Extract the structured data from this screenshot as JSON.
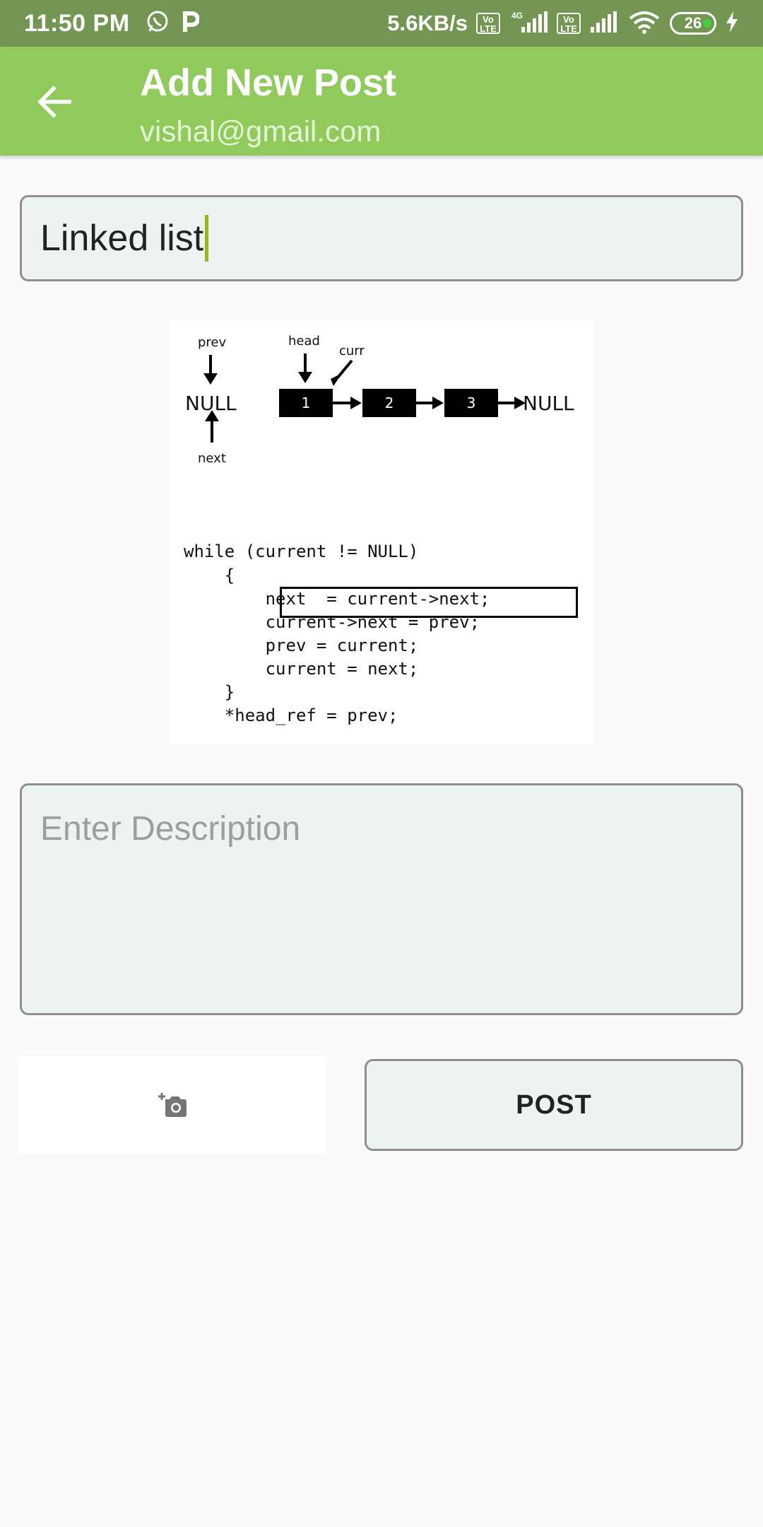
{
  "status_bar": {
    "time": "11:50 PM",
    "net_speed": "5.6KB/s",
    "volte_label": "Vo LTE",
    "network_type": "4G",
    "battery_level": "26",
    "icons": [
      "whatsapp-icon",
      "p-app-icon",
      "volte-icon",
      "signal-icon",
      "wifi-icon",
      "battery-icon",
      "charging-icon"
    ]
  },
  "app_bar": {
    "title": "Add New Post",
    "subtitle": "vishal@gmail.com",
    "back_icon": "arrow-back-icon"
  },
  "colors": {
    "status_bar": "#739653",
    "app_bar": "#8fca5a",
    "input_bg": "#edf3f2",
    "caret": "#9ab814"
  },
  "form": {
    "title_value": "Linked list",
    "description_placeholder": "Enter Description",
    "post_label": "POST",
    "camera_icon": "add-photo-icon"
  },
  "preview": {
    "labels": {
      "prev": "prev",
      "head": "head",
      "curr": "curr",
      "next": "next",
      "null_left": "NULL",
      "null_right": "NULL"
    },
    "nodes": [
      "1",
      "2",
      "3"
    ],
    "code_lines": [
      "while (current != NULL)",
      "    {",
      "        next  = current->next;",
      "        current->next = prev;",
      "        prev = current;",
      "        current = next;",
      "    }",
      "    *head_ref = prev;"
    ]
  }
}
